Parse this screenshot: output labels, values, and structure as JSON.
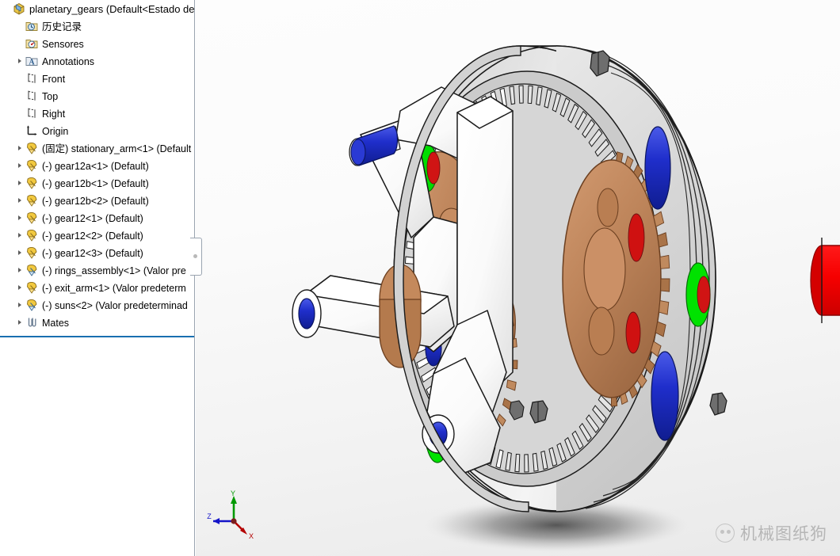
{
  "app": {
    "document_title": "planetary_gears",
    "document_config": "(Default<Estado de"
  },
  "tree": {
    "root": {
      "label": "planetary_gears  (Default<Estado de",
      "icon": "assembly-icon",
      "has_twisty": false,
      "indent": 0
    },
    "items": [
      {
        "label": "历史记录",
        "icon": "history-folder-icon",
        "has_twisty": false,
        "indent": 1
      },
      {
        "label": "Sensores",
        "icon": "sensors-folder-icon",
        "has_twisty": false,
        "indent": 1
      },
      {
        "label": "Annotations",
        "icon": "annotations-folder-icon",
        "has_twisty": true,
        "indent": 1
      },
      {
        "label": "Front",
        "icon": "plane-icon",
        "has_twisty": false,
        "indent": 1
      },
      {
        "label": "Top",
        "icon": "plane-icon",
        "has_twisty": false,
        "indent": 1
      },
      {
        "label": "Right",
        "icon": "plane-icon",
        "has_twisty": false,
        "indent": 1
      },
      {
        "label": "Origin",
        "icon": "origin-icon",
        "has_twisty": false,
        "indent": 1
      },
      {
        "label": "(固定) stationary_arm<1>  (Default",
        "icon": "part-icon",
        "has_twisty": true,
        "indent": 1
      },
      {
        "label": "(-) gear12a<1>  (Default)",
        "icon": "part-icon",
        "has_twisty": true,
        "indent": 1
      },
      {
        "label": "(-) gear12b<1>  (Default)",
        "icon": "part-icon",
        "has_twisty": true,
        "indent": 1
      },
      {
        "label": "(-) gear12b<2>  (Default)",
        "icon": "part-icon",
        "has_twisty": true,
        "indent": 1
      },
      {
        "label": "(-) gear12<1>  (Default)",
        "icon": "part-icon",
        "has_twisty": true,
        "indent": 1
      },
      {
        "label": "(-) gear12<2>  (Default)",
        "icon": "part-icon",
        "has_twisty": true,
        "indent": 1
      },
      {
        "label": "(-) gear12<3>  (Default)",
        "icon": "part-icon",
        "has_twisty": true,
        "indent": 1
      },
      {
        "label": "(-) rings_assembly<1>  (Valor pre",
        "icon": "subassembly-icon",
        "has_twisty": true,
        "indent": 1
      },
      {
        "label": "(-) exit_arm<1>  (Valor predeterm",
        "icon": "part-icon",
        "has_twisty": true,
        "indent": 1
      },
      {
        "label": "(-) suns<2>  (Valor predeterminad",
        "icon": "subassembly-icon",
        "has_twisty": true,
        "indent": 1
      },
      {
        "label": "Mates",
        "icon": "mates-icon",
        "has_twisty": true,
        "indent": 1
      }
    ]
  },
  "viewport": {
    "model_name": "planetary_gears",
    "triad": {
      "y_label": "Y",
      "x_label": "X",
      "z_label": "Z",
      "y_color": "#009900",
      "x_color": "#cc0000",
      "z_color": "#0000cc"
    },
    "colors": {
      "background_top": "#fdfdfd",
      "background_bottom": "#e9e9e9",
      "housing_gray": "#d9d9d9",
      "carrier_white": "#ffffff",
      "planet_copper": "#c08a5e",
      "ring_gear_white": "#f2f2f2",
      "pin_blue": "#1a2fd0",
      "sun_green": "#00e000",
      "shaft_red": "#f50000",
      "bolt_gray": "#6e6e6e",
      "outline": "#1a1a1a"
    }
  },
  "watermark": {
    "text": "机械图纸狗",
    "logo": "wechat-logo-icon"
  },
  "splitter": {
    "handle": "panel-splitter-handle"
  }
}
